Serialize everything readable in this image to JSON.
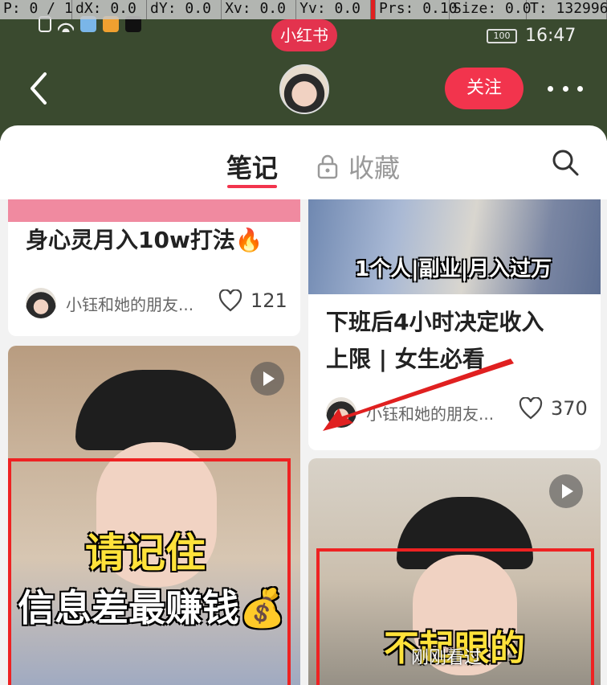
{
  "debug": {
    "p": "P: 0 / 1",
    "dx": "dX: 0.0",
    "dy": "dY: 0.0",
    "xv": "Xv: 0.0",
    "yv": "Yv: 0.0",
    "prs": "Prs: 0.10",
    "size": "Size: 0.0",
    "t": "T: 132996"
  },
  "status": {
    "brand": "小红书",
    "battery": "100",
    "time": "16:47"
  },
  "header": {
    "follow_label": "关注"
  },
  "tabs": {
    "notes": "笔记",
    "favorites": "收藏"
  },
  "feed": {
    "cards": [
      {
        "title": "身心灵月入10w打法🔥",
        "author": "小钰和她的朋友...",
        "likes": "121"
      },
      {
        "img_text": "1个人|副业|月入过万",
        "title_line1": "下班后4小时决定收入",
        "title_line2": "上限 | 女生必看",
        "author": "小钰和她的朋友...",
        "likes": "370"
      },
      {
        "img_line1": "请记住",
        "img_line2": "信息差最赚钱💰"
      },
      {
        "img_text": "不起眼的"
      }
    ],
    "recent_label": "刚刚看过"
  },
  "colors": {
    "accent": "#f2344d",
    "header_bg": "#3a4a2f"
  }
}
